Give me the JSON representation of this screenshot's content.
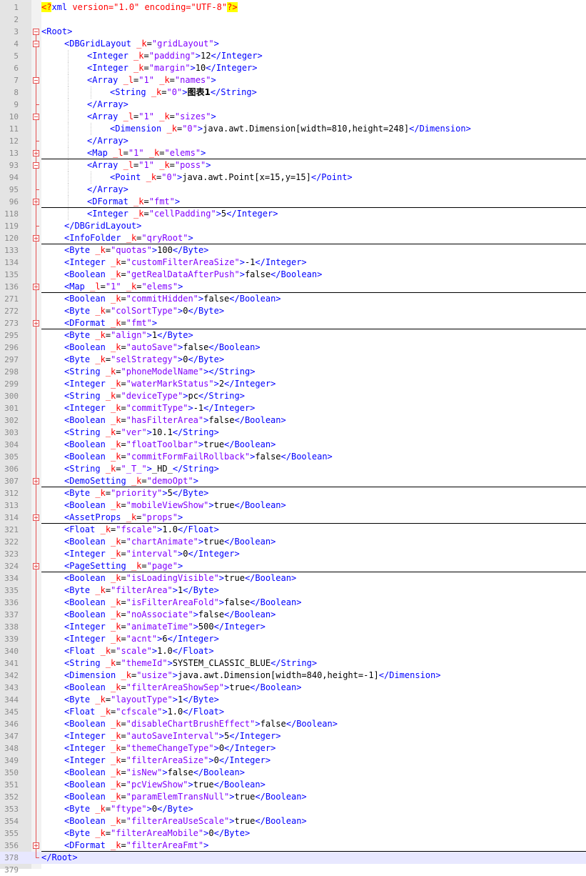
{
  "lines": [
    {
      "n": "1",
      "fold": "none",
      "indent": 0,
      "kind": "decl",
      "text": "version=\"1.0\" encoding=\"UTF-8\""
    },
    {
      "n": "2",
      "fold": "none",
      "indent": 0,
      "kind": "blank"
    },
    {
      "n": "3",
      "fold": "open-top",
      "indent": 0,
      "kind": "open",
      "tag": "Root"
    },
    {
      "n": "4",
      "fold": "open",
      "indent": 1,
      "kind": "open",
      "tag": "DBGridLayout",
      "attrs": [
        [
          "_k",
          "gridLayout"
        ]
      ]
    },
    {
      "n": "5",
      "fold": "bar",
      "indent": 2,
      "kind": "elem",
      "tag": "Integer",
      "attrs": [
        [
          "_k",
          "padding"
        ]
      ],
      "text": "12"
    },
    {
      "n": "6",
      "fold": "bar",
      "indent": 2,
      "kind": "elem",
      "tag": "Integer",
      "attrs": [
        [
          "_k",
          "margin"
        ]
      ],
      "text": "10"
    },
    {
      "n": "7",
      "fold": "open",
      "indent": 2,
      "kind": "open",
      "tag": "Array",
      "attrs": [
        [
          "_l",
          "1"
        ],
        [
          "_k",
          "names"
        ]
      ]
    },
    {
      "n": "8",
      "fold": "bar",
      "indent": 3,
      "kind": "elem",
      "tag": "String",
      "attrs": [
        [
          "_k",
          "0"
        ]
      ],
      "text": "图表1"
    },
    {
      "n": "9",
      "fold": "end",
      "indent": 2,
      "kind": "close",
      "tag": "Array"
    },
    {
      "n": "10",
      "fold": "open",
      "indent": 2,
      "kind": "open",
      "tag": "Array",
      "attrs": [
        [
          "_l",
          "1"
        ],
        [
          "_k",
          "sizes"
        ]
      ]
    },
    {
      "n": "11",
      "fold": "bar",
      "indent": 3,
      "kind": "elem",
      "tag": "Dimension",
      "attrs": [
        [
          "_k",
          "0"
        ]
      ],
      "text": "java.awt.Dimension[width=810,height=248]"
    },
    {
      "n": "12",
      "fold": "end",
      "indent": 2,
      "kind": "close",
      "tag": "Array"
    },
    {
      "n": "13",
      "fold": "closed",
      "indent": 2,
      "kind": "open",
      "tag": "Map",
      "attrs": [
        [
          "_l",
          "1"
        ],
        [
          "_k",
          "elems"
        ]
      ]
    },
    {
      "n": "93",
      "fold": "open",
      "indent": 2,
      "kind": "open",
      "tag": "Array",
      "attrs": [
        [
          "_l",
          "1"
        ],
        [
          "_k",
          "poss"
        ]
      ]
    },
    {
      "n": "94",
      "fold": "bar",
      "indent": 3,
      "kind": "elem",
      "tag": "Point",
      "attrs": [
        [
          "_k",
          "0"
        ]
      ],
      "text": "java.awt.Point[x=15,y=15]"
    },
    {
      "n": "95",
      "fold": "end",
      "indent": 2,
      "kind": "close",
      "tag": "Array"
    },
    {
      "n": "96",
      "fold": "closed",
      "indent": 2,
      "kind": "open",
      "tag": "DFormat",
      "attrs": [
        [
          "_k",
          "fmt"
        ]
      ]
    },
    {
      "n": "118",
      "fold": "bar",
      "indent": 2,
      "kind": "elem",
      "tag": "Integer",
      "attrs": [
        [
          "_k",
          "cellPadding"
        ]
      ],
      "text": "5"
    },
    {
      "n": "119",
      "fold": "end",
      "indent": 1,
      "kind": "close",
      "tag": "DBGridLayout"
    },
    {
      "n": "120",
      "fold": "closed",
      "indent": 1,
      "kind": "open",
      "tag": "InfoFolder",
      "attrs": [
        [
          "_k",
          "qryRoot"
        ]
      ]
    },
    {
      "n": "133",
      "fold": "bar",
      "indent": 1,
      "kind": "elem",
      "tag": "Byte",
      "attrs": [
        [
          "_k",
          "quotas"
        ]
      ],
      "text": "100"
    },
    {
      "n": "134",
      "fold": "bar",
      "indent": 1,
      "kind": "elem",
      "tag": "Integer",
      "attrs": [
        [
          "_k",
          "customFilterAreaSize"
        ]
      ],
      "text": "-1"
    },
    {
      "n": "135",
      "fold": "bar",
      "indent": 1,
      "kind": "elem",
      "tag": "Boolean",
      "attrs": [
        [
          "_k",
          "getRealDataAfterPush"
        ]
      ],
      "text": "false"
    },
    {
      "n": "136",
      "fold": "closed",
      "indent": 1,
      "kind": "open",
      "tag": "Map",
      "attrs": [
        [
          "_l",
          "1"
        ],
        [
          "_k",
          "elems"
        ]
      ]
    },
    {
      "n": "271",
      "fold": "bar",
      "indent": 1,
      "kind": "elem",
      "tag": "Boolean",
      "attrs": [
        [
          "_k",
          "commitHidden"
        ]
      ],
      "text": "false"
    },
    {
      "n": "272",
      "fold": "bar",
      "indent": 1,
      "kind": "elem",
      "tag": "Byte",
      "attrs": [
        [
          "_k",
          "colSortType"
        ]
      ],
      "text": "0"
    },
    {
      "n": "273",
      "fold": "closed",
      "indent": 1,
      "kind": "open",
      "tag": "DFormat",
      "attrs": [
        [
          "_k",
          "fmt"
        ]
      ]
    },
    {
      "n": "295",
      "fold": "bar",
      "indent": 1,
      "kind": "elem",
      "tag": "Byte",
      "attrs": [
        [
          "_k",
          "align"
        ]
      ],
      "text": "1"
    },
    {
      "n": "296",
      "fold": "bar",
      "indent": 1,
      "kind": "elem",
      "tag": "Boolean",
      "attrs": [
        [
          "_k",
          "autoSave"
        ]
      ],
      "text": "false"
    },
    {
      "n": "297",
      "fold": "bar",
      "indent": 1,
      "kind": "elem",
      "tag": "Byte",
      "attrs": [
        [
          "_k",
          "selStrategy"
        ]
      ],
      "text": "0"
    },
    {
      "n": "298",
      "fold": "bar",
      "indent": 1,
      "kind": "elem",
      "tag": "String",
      "attrs": [
        [
          "_k",
          "phoneModelName"
        ]
      ],
      "text": ""
    },
    {
      "n": "299",
      "fold": "bar",
      "indent": 1,
      "kind": "elem",
      "tag": "Integer",
      "attrs": [
        [
          "_k",
          "waterMarkStatus"
        ]
      ],
      "text": "2"
    },
    {
      "n": "300",
      "fold": "bar",
      "indent": 1,
      "kind": "elem",
      "tag": "String",
      "attrs": [
        [
          "_k",
          "deviceType"
        ]
      ],
      "text": "pc"
    },
    {
      "n": "301",
      "fold": "bar",
      "indent": 1,
      "kind": "elem",
      "tag": "Integer",
      "attrs": [
        [
          "_k",
          "commitType"
        ]
      ],
      "text": "-1"
    },
    {
      "n": "302",
      "fold": "bar",
      "indent": 1,
      "kind": "elem",
      "tag": "Boolean",
      "attrs": [
        [
          "_k",
          "hasFilterArea"
        ]
      ],
      "text": "false"
    },
    {
      "n": "303",
      "fold": "bar",
      "indent": 1,
      "kind": "elem",
      "tag": "String",
      "attrs": [
        [
          "_k",
          "ver"
        ]
      ],
      "text": "10.1"
    },
    {
      "n": "304",
      "fold": "bar",
      "indent": 1,
      "kind": "elem",
      "tag": "Boolean",
      "attrs": [
        [
          "_k",
          "floatToolbar"
        ]
      ],
      "text": "true"
    },
    {
      "n": "305",
      "fold": "bar",
      "indent": 1,
      "kind": "elem",
      "tag": "Boolean",
      "attrs": [
        [
          "_k",
          "commitFormFailRollback"
        ]
      ],
      "text": "false"
    },
    {
      "n": "306",
      "fold": "bar",
      "indent": 1,
      "kind": "elem",
      "tag": "String",
      "attrs": [
        [
          "_k",
          "_T_"
        ]
      ],
      "text": "_HD_"
    },
    {
      "n": "307",
      "fold": "closed",
      "indent": 1,
      "kind": "open",
      "tag": "DemoSetting",
      "attrs": [
        [
          "_k",
          "demoOpt"
        ]
      ]
    },
    {
      "n": "312",
      "fold": "bar",
      "indent": 1,
      "kind": "elem",
      "tag": "Byte",
      "attrs": [
        [
          "_k",
          "priority"
        ]
      ],
      "text": "5"
    },
    {
      "n": "313",
      "fold": "bar",
      "indent": 1,
      "kind": "elem",
      "tag": "Boolean",
      "attrs": [
        [
          "_k",
          "mobileViewShow"
        ]
      ],
      "text": "true"
    },
    {
      "n": "314",
      "fold": "closed",
      "indent": 1,
      "kind": "open",
      "tag": "AssetProps",
      "attrs": [
        [
          "_k",
          "props"
        ]
      ]
    },
    {
      "n": "321",
      "fold": "bar",
      "indent": 1,
      "kind": "elem",
      "tag": "Float",
      "attrs": [
        [
          "_k",
          "fscale"
        ]
      ],
      "text": "1.0"
    },
    {
      "n": "322",
      "fold": "bar",
      "indent": 1,
      "kind": "elem",
      "tag": "Boolean",
      "attrs": [
        [
          "_k",
          "chartAnimate"
        ]
      ],
      "text": "true"
    },
    {
      "n": "323",
      "fold": "bar",
      "indent": 1,
      "kind": "elem",
      "tag": "Integer",
      "attrs": [
        [
          "_k",
          "interval"
        ]
      ],
      "text": "0"
    },
    {
      "n": "324",
      "fold": "closed",
      "indent": 1,
      "kind": "open",
      "tag": "PageSetting",
      "attrs": [
        [
          "_k",
          "page"
        ]
      ]
    },
    {
      "n": "334",
      "fold": "bar",
      "indent": 1,
      "kind": "elem",
      "tag": "Boolean",
      "attrs": [
        [
          "_k",
          "isLoadingVisible"
        ]
      ],
      "text": "true"
    },
    {
      "n": "335",
      "fold": "bar",
      "indent": 1,
      "kind": "elem",
      "tag": "Byte",
      "attrs": [
        [
          "_k",
          "filterArea"
        ]
      ],
      "text": "1"
    },
    {
      "n": "336",
      "fold": "bar",
      "indent": 1,
      "kind": "elem",
      "tag": "Boolean",
      "attrs": [
        [
          "_k",
          "isFilterAreaFold"
        ]
      ],
      "text": "false"
    },
    {
      "n": "337",
      "fold": "bar",
      "indent": 1,
      "kind": "elem",
      "tag": "Boolean",
      "attrs": [
        [
          "_k",
          "noAssociate"
        ]
      ],
      "text": "false"
    },
    {
      "n": "338",
      "fold": "bar",
      "indent": 1,
      "kind": "elem",
      "tag": "Integer",
      "attrs": [
        [
          "_k",
          "animateTime"
        ]
      ],
      "text": "500"
    },
    {
      "n": "339",
      "fold": "bar",
      "indent": 1,
      "kind": "elem",
      "tag": "Integer",
      "attrs": [
        [
          "_k",
          "acnt"
        ]
      ],
      "text": "6"
    },
    {
      "n": "340",
      "fold": "bar",
      "indent": 1,
      "kind": "elem",
      "tag": "Float",
      "attrs": [
        [
          "_k",
          "scale"
        ]
      ],
      "text": "1.0"
    },
    {
      "n": "341",
      "fold": "bar",
      "indent": 1,
      "kind": "elem",
      "tag": "String",
      "attrs": [
        [
          "_k",
          "themeId"
        ]
      ],
      "text": "SYSTEM_CLASSIC_BLUE"
    },
    {
      "n": "342",
      "fold": "bar",
      "indent": 1,
      "kind": "elem",
      "tag": "Dimension",
      "attrs": [
        [
          "_k",
          "usize"
        ]
      ],
      "text": "java.awt.Dimension[width=840,height=-1]"
    },
    {
      "n": "343",
      "fold": "bar",
      "indent": 1,
      "kind": "elem",
      "tag": "Boolean",
      "attrs": [
        [
          "_k",
          "filterAreaShowSep"
        ]
      ],
      "text": "true"
    },
    {
      "n": "344",
      "fold": "bar",
      "indent": 1,
      "kind": "elem",
      "tag": "Byte",
      "attrs": [
        [
          "_k",
          "layoutType"
        ]
      ],
      "text": "1"
    },
    {
      "n": "345",
      "fold": "bar",
      "indent": 1,
      "kind": "elem",
      "tag": "Float",
      "attrs": [
        [
          "_k",
          "cfscale"
        ]
      ],
      "text": "1.0"
    },
    {
      "n": "346",
      "fold": "bar",
      "indent": 1,
      "kind": "elem",
      "tag": "Boolean",
      "attrs": [
        [
          "_k",
          "disableChartBrushEffect"
        ]
      ],
      "text": "false"
    },
    {
      "n": "347",
      "fold": "bar",
      "indent": 1,
      "kind": "elem",
      "tag": "Integer",
      "attrs": [
        [
          "_k",
          "autoSaveInterval"
        ]
      ],
      "text": "5"
    },
    {
      "n": "348",
      "fold": "bar",
      "indent": 1,
      "kind": "elem",
      "tag": "Integer",
      "attrs": [
        [
          "_k",
          "themeChangeType"
        ]
      ],
      "text": "0"
    },
    {
      "n": "349",
      "fold": "bar",
      "indent": 1,
      "kind": "elem",
      "tag": "Integer",
      "attrs": [
        [
          "_k",
          "filterAreaSize"
        ]
      ],
      "text": "0"
    },
    {
      "n": "350",
      "fold": "bar",
      "indent": 1,
      "kind": "elem",
      "tag": "Boolean",
      "attrs": [
        [
          "_k",
          "isNew"
        ]
      ],
      "text": "false"
    },
    {
      "n": "351",
      "fold": "bar",
      "indent": 1,
      "kind": "elem",
      "tag": "Boolean",
      "attrs": [
        [
          "_k",
          "pcViewShow"
        ]
      ],
      "text": "true"
    },
    {
      "n": "352",
      "fold": "bar",
      "indent": 1,
      "kind": "elem",
      "tag": "Boolean",
      "attrs": [
        [
          "_k",
          "paramElemTransNull"
        ]
      ],
      "text": "true"
    },
    {
      "n": "353",
      "fold": "bar",
      "indent": 1,
      "kind": "elem",
      "tag": "Byte",
      "attrs": [
        [
          "_k",
          "ftype"
        ]
      ],
      "text": "0"
    },
    {
      "n": "354",
      "fold": "bar",
      "indent": 1,
      "kind": "elem",
      "tag": "Boolean",
      "attrs": [
        [
          "_k",
          "filterAreaUseScale"
        ]
      ],
      "text": "true"
    },
    {
      "n": "355",
      "fold": "bar",
      "indent": 1,
      "kind": "elem",
      "tag": "Byte",
      "attrs": [
        [
          "_k",
          "filterAreaMobile"
        ]
      ],
      "text": "0"
    },
    {
      "n": "356",
      "fold": "closed",
      "indent": 1,
      "kind": "open",
      "tag": "DFormat",
      "attrs": [
        [
          "_k",
          "filterAreaFmt"
        ]
      ]
    },
    {
      "n": "378",
      "fold": "end",
      "indent": 0,
      "kind": "close",
      "tag": "Root",
      "highlight": true
    },
    {
      "n": "379",
      "fold": "none",
      "indent": 0,
      "kind": "blank"
    }
  ],
  "colors": {
    "tag": "#0000ff",
    "attr": "#ff0000",
    "value": "#8000ff",
    "text": "#000000",
    "gutter": "#e4e4e4",
    "fold_marker": "#e45050",
    "current_line": "#e8e8ff"
  },
  "icons": {
    "fold_open": "minus-box-icon",
    "fold_closed": "plus-box-icon"
  }
}
